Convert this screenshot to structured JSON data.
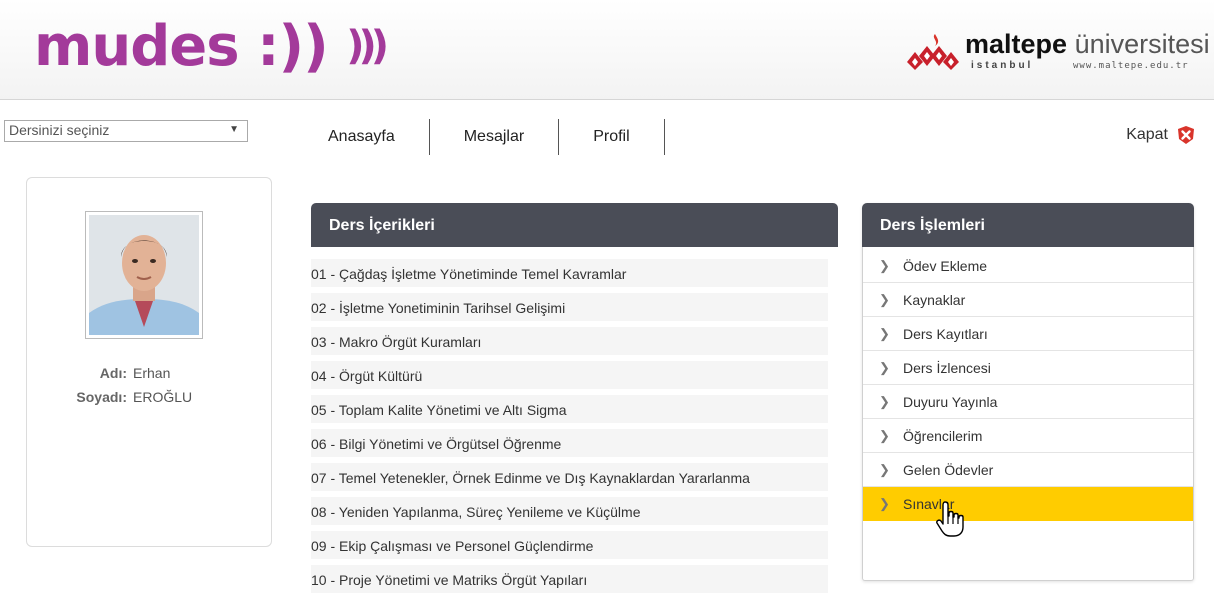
{
  "header": {
    "brand_text": "mudes",
    "brand_symbol": ":))",
    "brand_waves": ")))",
    "university_name_bold": "maltepe",
    "university_name_light": "üniversitesi",
    "university_city": "istanbul",
    "university_url": "www.maltepe.edu.tr"
  },
  "navbar": {
    "course_select_value": "Dersinizi seçiniz",
    "items": [
      "Anasayfa",
      "Mesajlar",
      "Profil"
    ],
    "close_label": "Kapat"
  },
  "profile": {
    "first_name_label": "Adı:",
    "first_name": "Erhan",
    "last_name_label": "Soyadı:",
    "last_name": "EROĞLU"
  },
  "course_contents": {
    "title": "Ders İçerikleri",
    "items": [
      "01 - Çağdaş İşletme Yönetiminde Temel Kavramlar",
      "02 - İşletme Yonetiminin Tarihsel Gelişimi",
      "03 - Makro Örgüt Kuramları",
      "04 - Örgüt Kültürü",
      "05 - Toplam Kalite Yönetimi ve Altı Sigma",
      "06 - Bilgi Yönetimi ve Örgütsel Öğrenme",
      "07 - Temel Yetenekler, Örnek Edinme ve Dış Kaynaklardan Yararlanma",
      "08 - Yeniden Yapılanma, Süreç Yenileme ve Küçülme",
      "09 - Ekip Çalışması ve Personel Güçlendirme",
      "10 - Proje Yönetimi ve Matriks Örgüt Yapıları"
    ]
  },
  "course_operations": {
    "title": "Ders İşlemleri",
    "items": [
      "Ödev Ekleme",
      "Kaynaklar",
      "Ders Kayıtları",
      "Ders İzlencesi",
      "Duyuru Yayınla",
      "Öğrencilerim",
      "Gelen Ödevler",
      "Sınavlar"
    ],
    "active_index": 7
  },
  "colors": {
    "brand": "#a33a9a",
    "panel_header": "#4a4d57",
    "active_highlight": "#ffcc00",
    "close_icon": "#d9342b"
  }
}
